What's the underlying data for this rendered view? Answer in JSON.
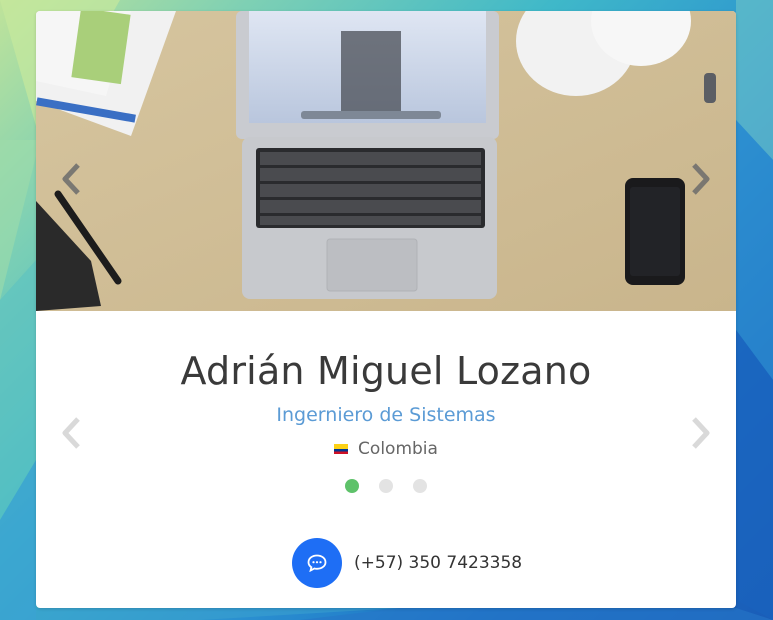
{
  "profile": {
    "name": "Adrián Miguel Lozano",
    "role": "Ingerniero de Sistemas",
    "country": "Colombia",
    "phone": "(+57) 350 7423358"
  },
  "carousel": {
    "slides": 3,
    "active_index": 0
  },
  "icons": {
    "prev": "chevron-left-icon",
    "next": "chevron-right-icon",
    "chat": "chat-bubble-icon",
    "flag": "flag-colombia-icon"
  },
  "colors": {
    "accent_blue": "#1e6ef5",
    "role_text": "#5b9bd5",
    "active_dot": "#5ec26a",
    "inactive_dot": "#e3e3e3"
  }
}
